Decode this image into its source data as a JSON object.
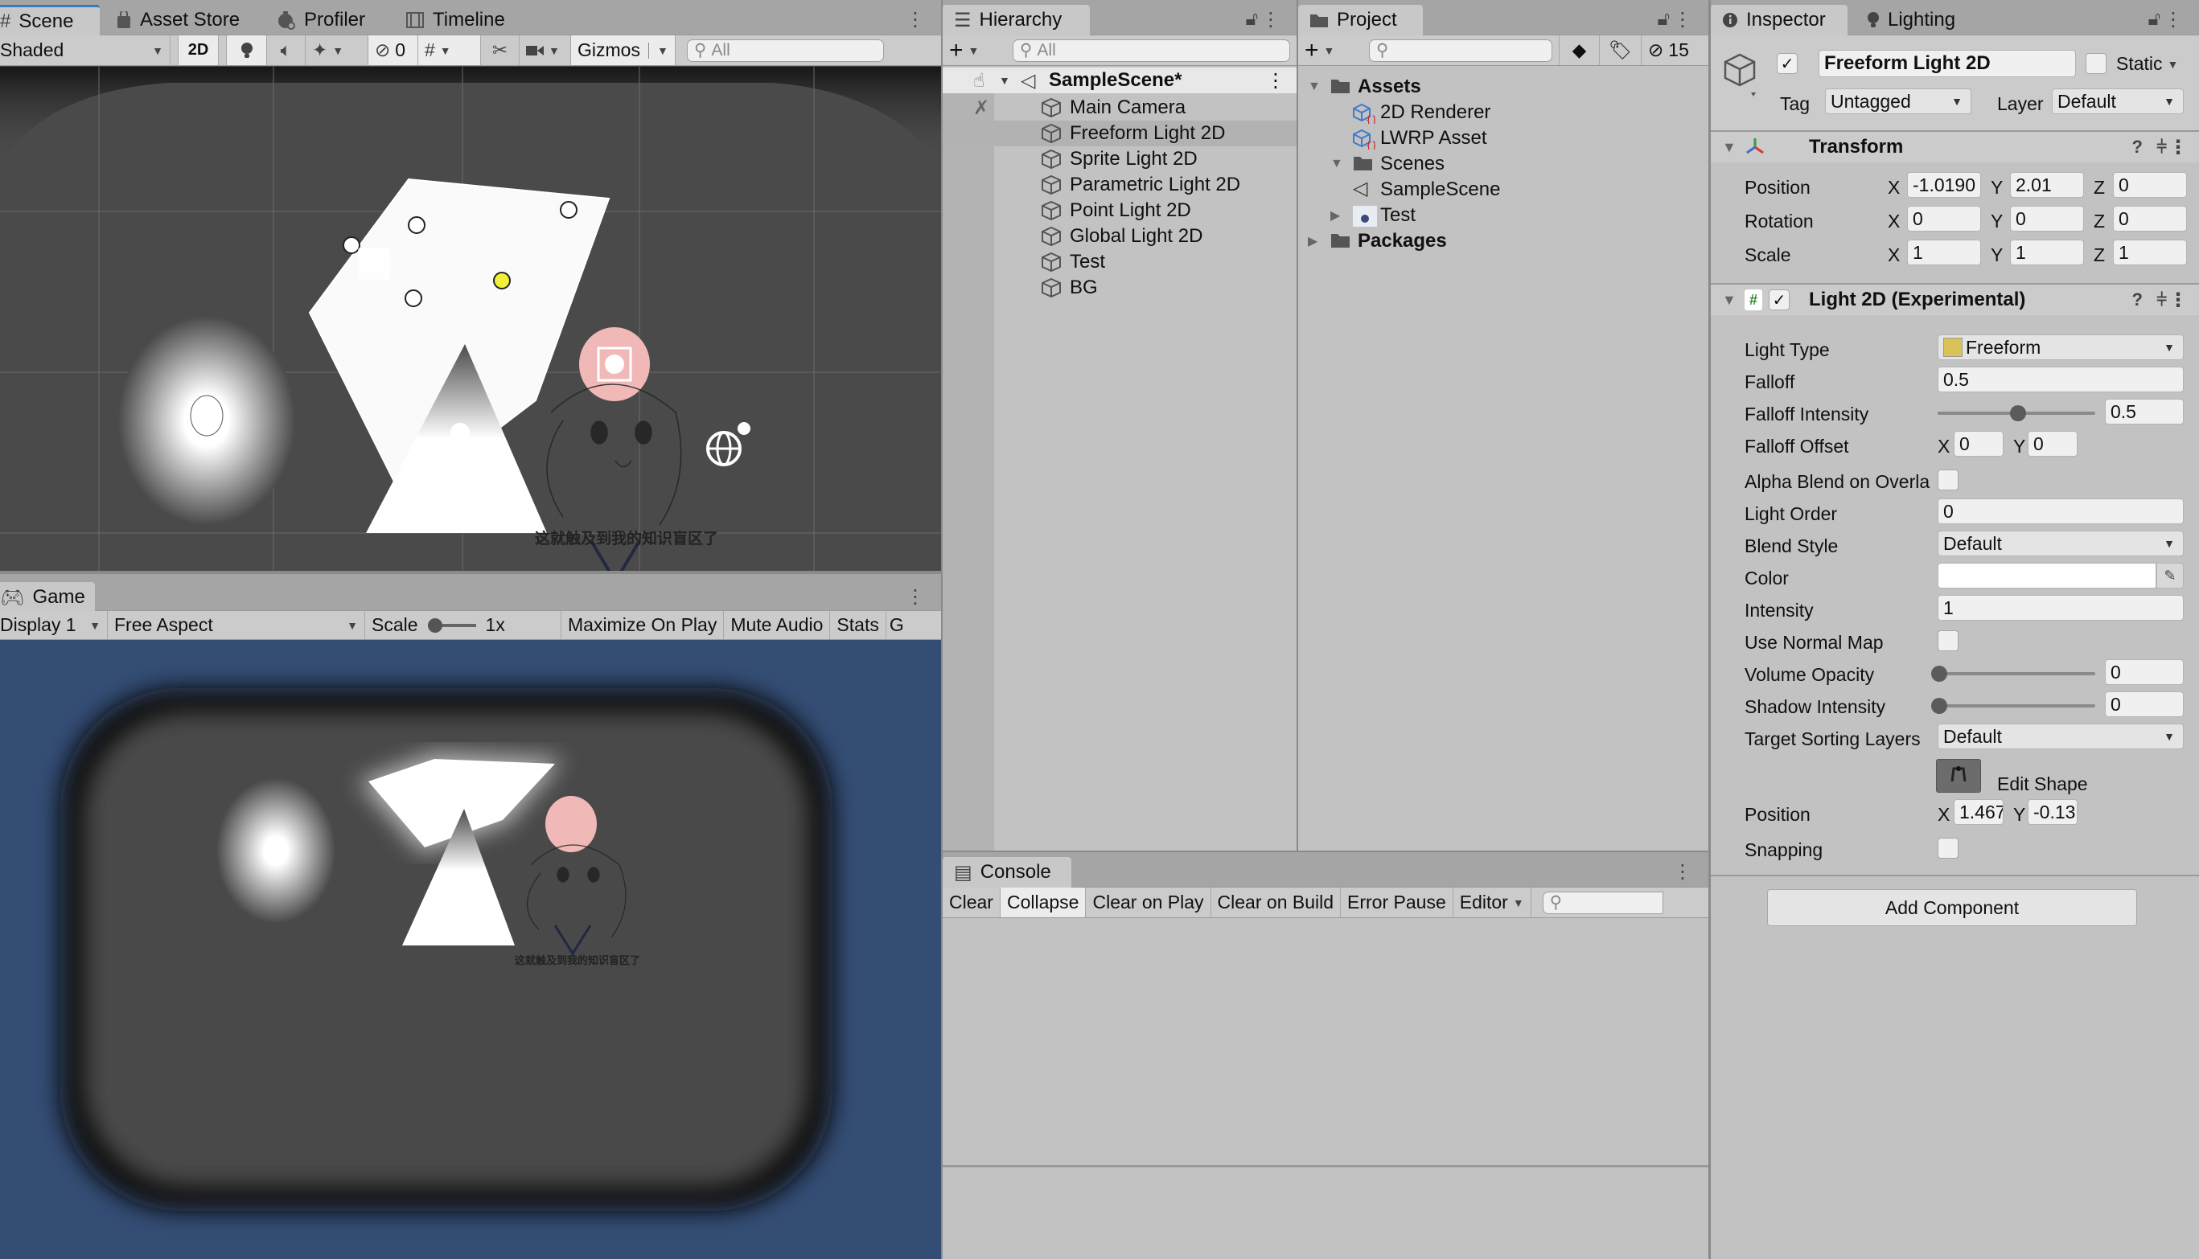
{
  "scene_panel": {
    "tabs": [
      {
        "label": "Scene",
        "icon": "grid-hash-icon",
        "active": true
      },
      {
        "label": "Asset Store",
        "icon": "shopping-bag-icon",
        "active": false
      },
      {
        "label": "Profiler",
        "icon": "stopwatch-icon",
        "active": false
      },
      {
        "label": "Timeline",
        "icon": "film-strip-icon",
        "active": false
      }
    ],
    "toolbar": {
      "draw_mode": "Shaded",
      "mode_2d": "2D",
      "hidden_count": "0",
      "gizmos": "Gizmos",
      "search_placeholder": "All"
    },
    "scene_text": "这就触及到我的知识盲区了"
  },
  "game_panel": {
    "tab": {
      "label": "Game",
      "icon": "gamepad-icon"
    },
    "toolbar": {
      "display": "Display 1",
      "aspect": "Free Aspect",
      "scale_label": "Scale",
      "scale_value": "1x",
      "maximize": "Maximize On Play",
      "mute": "Mute Audio",
      "stats": "Stats",
      "gizmos_cut": "G"
    },
    "background_color": "#344d74",
    "scene_text": "这就触及到我的知识盲区了"
  },
  "hierarchy": {
    "tab": "Hierarchy",
    "search_placeholder": "All",
    "scene": "SampleScene*",
    "items": [
      {
        "label": "Main Camera"
      },
      {
        "label": "Freeform Light 2D",
        "selected": true
      },
      {
        "label": "Sprite Light 2D"
      },
      {
        "label": "Parametric Light 2D"
      },
      {
        "label": "Point Light 2D"
      },
      {
        "label": "Global Light 2D"
      },
      {
        "label": "Test"
      },
      {
        "label": "BG"
      }
    ]
  },
  "project": {
    "tab": "Project",
    "hidden_count": "15",
    "tree": [
      {
        "label": "Assets",
        "bold": true,
        "expanded": true,
        "icon": "folder-open-icon"
      },
      {
        "label": "2D Renderer",
        "icon": "scriptable-object-icon"
      },
      {
        "label": "LWRP Asset",
        "icon": "scriptable-object-icon"
      },
      {
        "label": "Scenes",
        "expanded": true,
        "icon": "folder-open-icon"
      },
      {
        "label": "SampleScene",
        "icon": "unity-scene-icon"
      },
      {
        "label": "Test",
        "collapsed": true,
        "icon": "texture-thumbnail-icon"
      },
      {
        "label": "Packages",
        "bold": true,
        "collapsed": true,
        "icon": "folder-icon"
      }
    ]
  },
  "console": {
    "tab": "Console",
    "buttons": [
      "Clear",
      "Collapse",
      "Clear on Play",
      "Clear on Build",
      "Error Pause",
      "Editor"
    ],
    "active_button": "Collapse"
  },
  "inspector": {
    "tabs": [
      {
        "label": "Inspector",
        "icon": "info-icon",
        "active": true
      },
      {
        "label": "Lighting",
        "icon": "lightbulb-icon",
        "active": false
      }
    ],
    "object": {
      "enabled": true,
      "name": "Freeform Light 2D",
      "static_label": "Static",
      "static": false,
      "tag_label": "Tag",
      "tag": "Untagged",
      "layer_label": "Layer",
      "layer": "Default"
    },
    "transform": {
      "title": "Transform",
      "rows": [
        {
          "label": "Position",
          "x": "-1.0190",
          "y": "2.01",
          "z": "0"
        },
        {
          "label": "Rotation",
          "x": "0",
          "y": "0",
          "z": "0"
        },
        {
          "label": "Scale",
          "x": "1",
          "y": "1",
          "z": "1"
        }
      ]
    },
    "light2d": {
      "title": "Light 2D (Experimental)",
      "enabled": true,
      "light_type_label": "Light Type",
      "light_type": "Freeform",
      "falloff_label": "Falloff",
      "falloff": "0.5",
      "falloff_intensity_label": "Falloff Intensity",
      "falloff_intensity": "0.5",
      "falloff_intensity_fraction": 0.5,
      "falloff_offset_label": "Falloff Offset",
      "falloff_offset_x": "0",
      "falloff_offset_y": "0",
      "alpha_blend_label": "Alpha Blend on Overlа",
      "alpha_blend": false,
      "light_order_label": "Light Order",
      "light_order": "0",
      "blend_style_label": "Blend Style",
      "blend_style": "Default",
      "color_label": "Color",
      "color": "#ffffff",
      "intensity_label": "Intensity",
      "intensity": "1",
      "normal_map_label": "Use Normal Map",
      "normal_map": false,
      "volume_opacity_label": "Volume Opacity",
      "volume_opacity": "0",
      "volume_opacity_fraction": 0,
      "shadow_intensity_label": "Shadow Intensity",
      "shadow_intensity": "0",
      "shadow_intensity_fraction": 0,
      "sorting_layers_label": "Target Sorting Layers",
      "sorting_layers": "Default",
      "edit_shape_label": "Edit Shape",
      "position_label": "Position",
      "position_x": "1.467",
      "position_y": "-0.13",
      "snapping_label": "Snapping",
      "snapping": false
    },
    "add_component": "Add Component"
  },
  "axis_labels": {
    "x": "X",
    "y": "Y",
    "z": "Z"
  }
}
